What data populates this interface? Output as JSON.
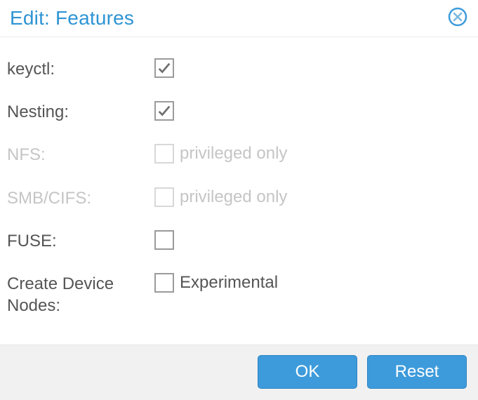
{
  "dialog": {
    "title": "Edit: Features"
  },
  "form": {
    "rows": [
      {
        "label": "keyctl:",
        "checked": true,
        "disabled": false,
        "hint": ""
      },
      {
        "label": "Nesting:",
        "checked": true,
        "disabled": false,
        "hint": ""
      },
      {
        "label": "NFS:",
        "checked": false,
        "disabled": true,
        "hint": "privileged only"
      },
      {
        "label": "SMB/CIFS:",
        "checked": false,
        "disabled": true,
        "hint": "privileged only"
      },
      {
        "label": "FUSE:",
        "checked": false,
        "disabled": false,
        "hint": ""
      },
      {
        "label": "Create Device Nodes:",
        "checked": false,
        "disabled": false,
        "hint": "Experimental"
      }
    ]
  },
  "footer": {
    "ok": "OK",
    "reset": "Reset"
  }
}
